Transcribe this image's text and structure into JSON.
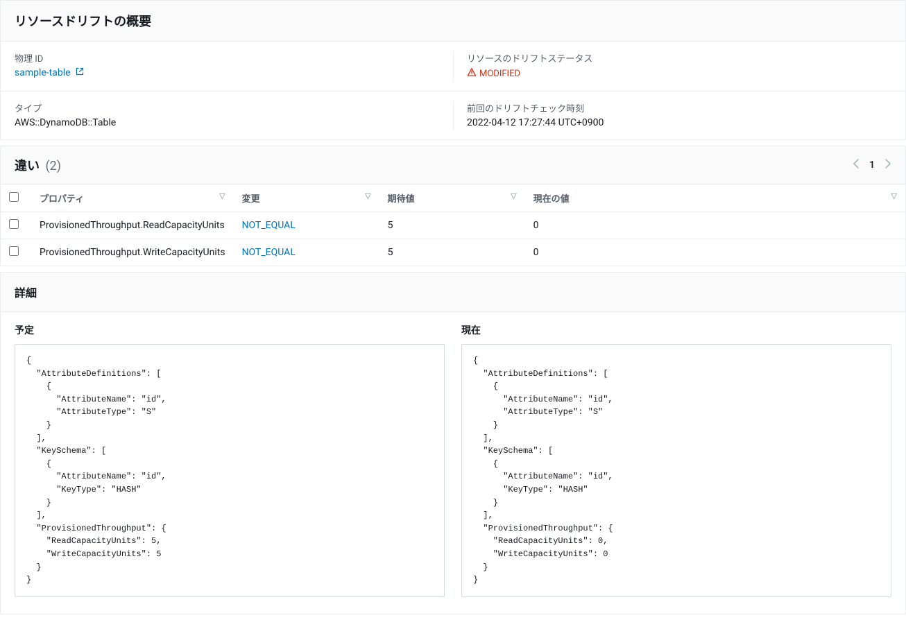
{
  "overview": {
    "title": "リソースドリフトの概要",
    "physicalId": {
      "label": "物理 ID",
      "value": "sample-table"
    },
    "status": {
      "label": "リソースのドリフトステータス",
      "value": "MODIFIED"
    },
    "type": {
      "label": "タイプ",
      "value": "AWS::DynamoDB::Table"
    },
    "lastCheck": {
      "label": "前回のドリフトチェック時刻",
      "value": "2022-04-12 17:27:44 UTC+0900"
    }
  },
  "differences": {
    "title": "違い",
    "count": "(2)",
    "page": {
      "current": "1"
    },
    "headers": {
      "property": "プロパティ",
      "change": "変更",
      "expected": "期待値",
      "current": "現在の値"
    },
    "rows": [
      {
        "property": "ProvisionedThroughput.ReadCapacityUnits",
        "change": "NOT_EQUAL",
        "expected": "5",
        "current": "0"
      },
      {
        "property": "ProvisionedThroughput.WriteCapacityUnits",
        "change": "NOT_EQUAL",
        "expected": "5",
        "current": "0"
      }
    ]
  },
  "details": {
    "title": "詳細",
    "expected": {
      "title": "予定",
      "json": "{\n  \"AttributeDefinitions\": [\n    {\n      \"AttributeName\": \"id\",\n      \"AttributeType\": \"S\"\n    }\n  ],\n  \"KeySchema\": [\n    {\n      \"AttributeName\": \"id\",\n      \"KeyType\": \"HASH\"\n    }\n  ],\n  \"ProvisionedThroughput\": {\n    \"ReadCapacityUnits\": 5,\n    \"WriteCapacityUnits\": 5\n  }\n}"
    },
    "current": {
      "title": "現在",
      "json": "{\n  \"AttributeDefinitions\": [\n    {\n      \"AttributeName\": \"id\",\n      \"AttributeType\": \"S\"\n    }\n  ],\n  \"KeySchema\": [\n    {\n      \"AttributeName\": \"id\",\n      \"KeyType\": \"HASH\"\n    }\n  ],\n  \"ProvisionedThroughput\": {\n    \"ReadCapacityUnits\": 0,\n    \"WriteCapacityUnits\": 0\n  }\n}"
    }
  }
}
